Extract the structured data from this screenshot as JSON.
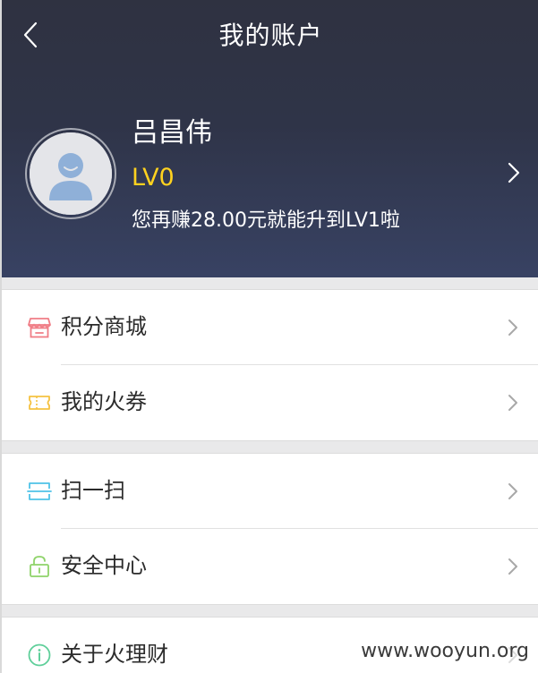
{
  "nav": {
    "title": "我的账户",
    "back_icon": "chevron-left-icon"
  },
  "profile": {
    "name": "吕昌伟",
    "level": "LV0",
    "upgrade_hint": "您再赚28.00元就能升到LV1啦",
    "level_color": "#ffd21f",
    "header_color": "#2f3448"
  },
  "groups": [
    {
      "items": [
        {
          "label": "积分商城",
          "icon": "store-icon",
          "icon_color": "#f07d86"
        },
        {
          "label": "我的火券",
          "icon": "ticket-icon",
          "icon_color": "#f5c242"
        }
      ]
    },
    {
      "items": [
        {
          "label": "扫一扫",
          "icon": "scan-icon",
          "icon_color": "#4fc3e8"
        },
        {
          "label": "安全中心",
          "icon": "lock-icon",
          "icon_color": "#8fd36a"
        }
      ]
    },
    {
      "items": [
        {
          "label": "关于火理财",
          "icon": "info-icon",
          "icon_color": "#5fcf9a"
        }
      ]
    }
  ],
  "watermark": "www.wooyun.org"
}
